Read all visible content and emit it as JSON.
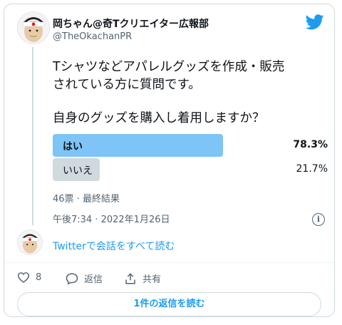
{
  "tweet": {
    "author_name": "岡ちゃん@奇Tクリエイター広報部",
    "author_handle": "@TheOkachanPR",
    "text_line1": "Tシャツなどアパレルグッズを作成・販売\nされている方に質問です。",
    "text_line2": "自身のグッズを購入し着用しますか？",
    "timestamp": "午後7:34 · 2022年1月26日"
  },
  "poll": {
    "options": [
      {
        "label": "はい",
        "percent_text": "78.3%",
        "percent": 78.3,
        "winner": true
      },
      {
        "label": "いいえ",
        "percent_text": "21.7%",
        "percent": 21.7,
        "winner": false
      }
    ],
    "summary": "46票 · 最終結果"
  },
  "conversation": {
    "link_text": "Twitterで会話をすべて読む"
  },
  "actions": {
    "like_count": "8",
    "reply_label": "返信",
    "share_label": "共有"
  },
  "replies_button": "1件の返信を読む",
  "colors": {
    "accent": "#1d9bf0",
    "winner_bar": "#7ec4f6",
    "loser_bar": "#cfd9de"
  },
  "icons": [
    "twitter-bird-icon",
    "info-icon",
    "heart-icon",
    "reply-bubble-icon",
    "share-icon"
  ]
}
